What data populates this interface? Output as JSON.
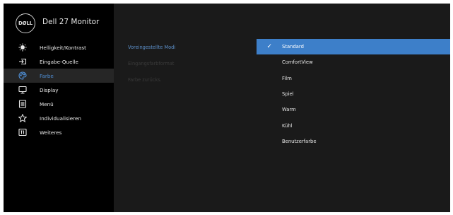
{
  "header": {
    "logo_text": "DØLL",
    "title": "Dell 27 Monitor"
  },
  "sidebar": {
    "items": [
      {
        "label": "Helligkeit/Kontrast",
        "icon": "brightness-icon"
      },
      {
        "label": "Eingabe-Quelle",
        "icon": "input-source-icon"
      },
      {
        "label": "Farbe",
        "icon": "color-palette-icon",
        "active": true
      },
      {
        "label": "Display",
        "icon": "display-icon"
      },
      {
        "label": "Menü",
        "icon": "menu-icon"
      },
      {
        "label": "Individualisieren",
        "icon": "star-icon"
      },
      {
        "label": "Weiteres",
        "icon": "info-icon"
      }
    ]
  },
  "submenu": {
    "items": [
      {
        "label": "Voreingestellte Modi",
        "active": true
      },
      {
        "label": "Eingangsfarbformat",
        "active": false
      },
      {
        "label": "Farbe zurücks.",
        "active": false
      }
    ]
  },
  "options": {
    "check": "✓",
    "items": [
      {
        "label": "Standard",
        "selected": true
      },
      {
        "label": "ComfortView"
      },
      {
        "label": "Film"
      },
      {
        "label": "Spiel"
      },
      {
        "label": "Warm"
      },
      {
        "label": "Kühl"
      },
      {
        "label": "Benutzerfarbe"
      }
    ]
  },
  "colors": {
    "accent": "#3d7fc9",
    "active_text": "#4f8fd6",
    "sidebar_bg": "#000000",
    "panel_bg": "#1a1a1a"
  }
}
